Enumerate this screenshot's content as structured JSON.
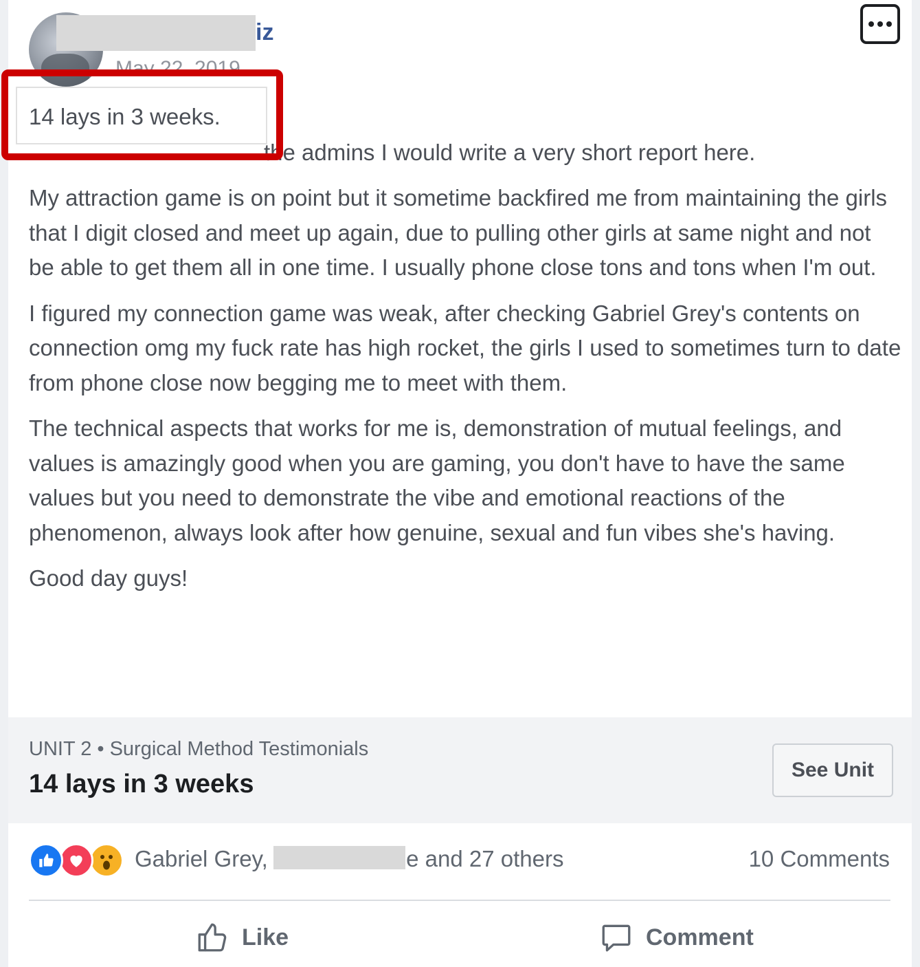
{
  "post": {
    "author_visible_suffix": "iz",
    "date": "May 22, 2019",
    "highlighted_title": "14 lays in 3 weeks.",
    "intro_line": "the admins I would write a very short report here.",
    "paragraphs": [
      "My attraction game is on point but it sometime backfired me from maintaining the girls that I digit closed and meet up again, due to pulling other girls at same night and not be able to get them all in one time. I usually phone close tons and tons when I'm out.",
      "I figured my connection game was weak, after checking Gabriel Grey's contents on connection omg my fuck rate has high rocket, the girls I used to sometimes turn to date from phone close now begging me to meet with them.",
      "The technical aspects that works for me is, demonstration of mutual feelings, and values is amazingly good when you are gaming, you don't have to have the same values but you need to demonstrate the vibe and emotional reactions of the phenomenon, always look after how genuine, sexual and fun vibes she's having.",
      "Good day guys!"
    ]
  },
  "unit": {
    "eyebrow": "UNIT 2 • Surgical Method Testimonials",
    "title": "14 lays in 3 weeks",
    "see_unit_label": "See Unit"
  },
  "reactions": {
    "names_start": "Gabriel Grey,",
    "names_end": "le and 27 others",
    "comments_label": "10 Comments",
    "icons": [
      "like-reaction-icon",
      "love-reaction-icon",
      "wow-reaction-icon"
    ]
  },
  "actions": {
    "like_label": "Like",
    "comment_label": "Comment"
  },
  "colors": {
    "highlight_border": "#cc0000",
    "author_link": "#385898",
    "like_blue": "#1877f2",
    "love_red": "#f33e58",
    "wow_yellow": "#f7b125"
  }
}
